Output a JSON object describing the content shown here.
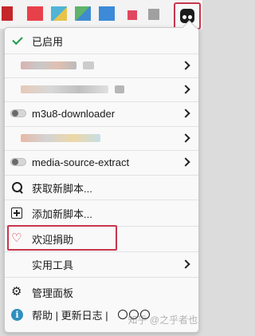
{
  "toolbar": {
    "extensions": [
      "ext-1",
      "ext-2",
      "ext-3",
      "ext-4",
      "ext-5",
      "ext-6",
      "ext-7"
    ],
    "tampermonkey_icon": "tampermonkey-icon"
  },
  "menu": {
    "enabled_label": "已启用",
    "scripts": [
      {
        "label": "m3u8-downloader",
        "enabled": false
      },
      {
        "label": "media-source-extract",
        "enabled": false
      }
    ],
    "get_new_script": "获取新脚本...",
    "add_new_script": "添加新脚本...",
    "donate": "欢迎捐助",
    "utilities": "实用工具",
    "dashboard": "管理面板",
    "footer": "帮助 | 更新日志 |"
  },
  "watermark": "知乎 @之乎者也",
  "colors": {
    "accent_red": "#c7364d",
    "check_green": "#1f9b4a",
    "info_blue": "#2f8fbf"
  }
}
